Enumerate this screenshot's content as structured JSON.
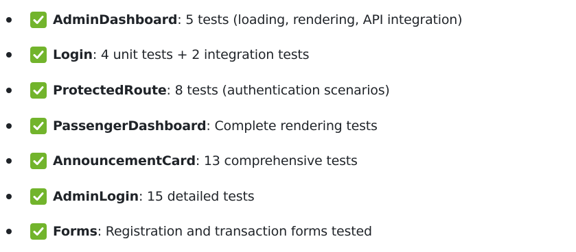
{
  "colors": {
    "check_bg": "#72b42c",
    "text": "#1f2328"
  },
  "icons": {
    "status": "check-mark-button-icon"
  },
  "items": [
    {
      "name": "AdminDashboard",
      "detail": ": 5 tests (loading, rendering, API integration)"
    },
    {
      "name": "Login",
      "detail": ": 4 unit tests + 2 integration tests"
    },
    {
      "name": "ProtectedRoute",
      "detail": ": 8 tests (authentication scenarios)"
    },
    {
      "name": "PassengerDashboard",
      "detail": ": Complete rendering tests"
    },
    {
      "name": "AnnouncementCard",
      "detail": ": 13 comprehensive tests"
    },
    {
      "name": "AdminLogin",
      "detail": ": 15 detailed tests"
    },
    {
      "name": "Forms",
      "detail": ": Registration and transaction forms tested"
    }
  ]
}
